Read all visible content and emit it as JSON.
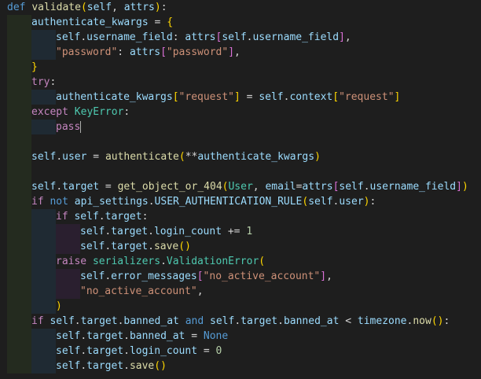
{
  "theme": {
    "background": "#1e1e1e",
    "indent_guide_colors": [
      "#242b1f",
      "#1f2a33",
      "#2a1f2f"
    ],
    "text": "#d4d4d4",
    "keyword": "#569cd6",
    "control": "#c586c0",
    "function": "#dcdcaa",
    "variable": "#9cdcfe",
    "string": "#ce9178",
    "class": "#4ec9b0",
    "number": "#b5cea8"
  },
  "editor": {
    "cursor_line": 8,
    "lines": [
      {
        "indent": 0,
        "tokens": [
          [
            "kw",
            "def "
          ],
          [
            "fn",
            "validate"
          ],
          [
            "br1",
            "("
          ],
          [
            "var",
            "self"
          ],
          [
            "op",
            ", "
          ],
          [
            "var",
            "attrs"
          ],
          [
            "br1",
            ")"
          ],
          [
            "op",
            ":"
          ]
        ]
      },
      {
        "indent": 1,
        "tokens": [
          [
            "var",
            "authenticate_kwargs"
          ],
          [
            "op",
            " = "
          ],
          [
            "br1",
            "{"
          ]
        ]
      },
      {
        "indent": 2,
        "tokens": [
          [
            "var",
            "self"
          ],
          [
            "op",
            "."
          ],
          [
            "var",
            "username_field"
          ],
          [
            "op",
            ": "
          ],
          [
            "var",
            "attrs"
          ],
          [
            "br2",
            "["
          ],
          [
            "var",
            "self"
          ],
          [
            "op",
            "."
          ],
          [
            "var",
            "username_field"
          ],
          [
            "br2",
            "]"
          ],
          [
            "op",
            ","
          ]
        ]
      },
      {
        "indent": 2,
        "tokens": [
          [
            "str",
            "\"password\""
          ],
          [
            "op",
            ": "
          ],
          [
            "var",
            "attrs"
          ],
          [
            "br2",
            "["
          ],
          [
            "str",
            "\"password\""
          ],
          [
            "br2",
            "]"
          ],
          [
            "op",
            ","
          ]
        ]
      },
      {
        "indent": 1,
        "tokens": [
          [
            "br1",
            "}"
          ]
        ]
      },
      {
        "indent": 1,
        "tokens": [
          [
            "ctl",
            "try"
          ],
          [
            "op",
            ":"
          ]
        ]
      },
      {
        "indent": 2,
        "tokens": [
          [
            "var",
            "authenticate_kwargs"
          ],
          [
            "br1",
            "["
          ],
          [
            "str",
            "\"request\""
          ],
          [
            "br1",
            "]"
          ],
          [
            "op",
            " = "
          ],
          [
            "var",
            "self"
          ],
          [
            "op",
            "."
          ],
          [
            "var",
            "context"
          ],
          [
            "br1",
            "["
          ],
          [
            "str",
            "\"request\""
          ],
          [
            "br1",
            "]"
          ]
        ]
      },
      {
        "indent": 1,
        "tokens": [
          [
            "ctl",
            "except "
          ],
          [
            "cls",
            "KeyError"
          ],
          [
            "op",
            ":"
          ]
        ]
      },
      {
        "indent": 2,
        "tokens": [
          [
            "ctl",
            "pass"
          ]
        ]
      },
      {
        "indent": 1,
        "tokens": []
      },
      {
        "indent": 1,
        "tokens": [
          [
            "var",
            "self"
          ],
          [
            "op",
            "."
          ],
          [
            "var",
            "user"
          ],
          [
            "op",
            " = "
          ],
          [
            "fn",
            "authenticate"
          ],
          [
            "br1",
            "("
          ],
          [
            "op",
            "**"
          ],
          [
            "var",
            "authenticate_kwargs"
          ],
          [
            "br1",
            ")"
          ]
        ]
      },
      {
        "indent": 1,
        "tokens": []
      },
      {
        "indent": 1,
        "tokens": [
          [
            "var",
            "self"
          ],
          [
            "op",
            "."
          ],
          [
            "var",
            "target"
          ],
          [
            "op",
            " = "
          ],
          [
            "fn",
            "get_object_or_404"
          ],
          [
            "br1",
            "("
          ],
          [
            "cls",
            "User"
          ],
          [
            "op",
            ", "
          ],
          [
            "var",
            "email"
          ],
          [
            "op",
            "="
          ],
          [
            "var",
            "attrs"
          ],
          [
            "br2",
            "["
          ],
          [
            "var",
            "self"
          ],
          [
            "op",
            "."
          ],
          [
            "var",
            "username_field"
          ],
          [
            "br2",
            "]"
          ],
          [
            "br1",
            ")"
          ]
        ]
      },
      {
        "indent": 1,
        "tokens": [
          [
            "ctl",
            "if "
          ],
          [
            "kw",
            "not "
          ],
          [
            "var",
            "api_settings"
          ],
          [
            "op",
            "."
          ],
          [
            "var",
            "USER_AUTHENTICATION_RULE"
          ],
          [
            "br1",
            "("
          ],
          [
            "var",
            "self"
          ],
          [
            "op",
            "."
          ],
          [
            "var",
            "user"
          ],
          [
            "br1",
            ")"
          ],
          [
            "op",
            ":"
          ]
        ]
      },
      {
        "indent": 2,
        "tokens": [
          [
            "ctl",
            "if "
          ],
          [
            "var",
            "self"
          ],
          [
            "op",
            "."
          ],
          [
            "var",
            "target"
          ],
          [
            "op",
            ":"
          ]
        ]
      },
      {
        "indent": 3,
        "tokens": [
          [
            "var",
            "self"
          ],
          [
            "op",
            "."
          ],
          [
            "var",
            "target"
          ],
          [
            "op",
            "."
          ],
          [
            "var",
            "login_count"
          ],
          [
            "op",
            " += "
          ],
          [
            "num",
            "1"
          ]
        ]
      },
      {
        "indent": 3,
        "tokens": [
          [
            "var",
            "self"
          ],
          [
            "op",
            "."
          ],
          [
            "var",
            "target"
          ],
          [
            "op",
            "."
          ],
          [
            "fn",
            "save"
          ],
          [
            "br1",
            "()"
          ]
        ]
      },
      {
        "indent": 2,
        "tokens": [
          [
            "ctl",
            "raise "
          ],
          [
            "cls",
            "serializers"
          ],
          [
            "op",
            "."
          ],
          [
            "cls",
            "ValidationError"
          ],
          [
            "br1",
            "("
          ]
        ]
      },
      {
        "indent": 3,
        "tokens": [
          [
            "var",
            "self"
          ],
          [
            "op",
            "."
          ],
          [
            "var",
            "error_messages"
          ],
          [
            "br2",
            "["
          ],
          [
            "str",
            "\"no_active_account\""
          ],
          [
            "br2",
            "]"
          ],
          [
            "op",
            ","
          ]
        ]
      },
      {
        "indent": 3,
        "tokens": [
          [
            "str",
            "\"no_active_account\""
          ],
          [
            "op",
            ","
          ]
        ]
      },
      {
        "indent": 2,
        "tokens": [
          [
            "br1",
            ")"
          ]
        ]
      },
      {
        "indent": 1,
        "tokens": [
          [
            "ctl",
            "if "
          ],
          [
            "var",
            "self"
          ],
          [
            "op",
            "."
          ],
          [
            "var",
            "target"
          ],
          [
            "op",
            "."
          ],
          [
            "var",
            "banned_at"
          ],
          [
            "kw",
            " and "
          ],
          [
            "var",
            "self"
          ],
          [
            "op",
            "."
          ],
          [
            "var",
            "target"
          ],
          [
            "op",
            "."
          ],
          [
            "var",
            "banned_at"
          ],
          [
            "op",
            " < "
          ],
          [
            "var",
            "timezone"
          ],
          [
            "op",
            "."
          ],
          [
            "fn",
            "now"
          ],
          [
            "br1",
            "()"
          ],
          [
            "op",
            ":"
          ]
        ]
      },
      {
        "indent": 2,
        "tokens": [
          [
            "var",
            "self"
          ],
          [
            "op",
            "."
          ],
          [
            "var",
            "target"
          ],
          [
            "op",
            "."
          ],
          [
            "var",
            "banned_at"
          ],
          [
            "op",
            " = "
          ],
          [
            "kw",
            "None"
          ]
        ]
      },
      {
        "indent": 2,
        "tokens": [
          [
            "var",
            "self"
          ],
          [
            "op",
            "."
          ],
          [
            "var",
            "target"
          ],
          [
            "op",
            "."
          ],
          [
            "var",
            "login_count"
          ],
          [
            "op",
            " = "
          ],
          [
            "num",
            "0"
          ]
        ]
      },
      {
        "indent": 2,
        "tokens": [
          [
            "var",
            "self"
          ],
          [
            "op",
            "."
          ],
          [
            "var",
            "target"
          ],
          [
            "op",
            "."
          ],
          [
            "fn",
            "save"
          ],
          [
            "br1",
            "()"
          ]
        ]
      }
    ]
  }
}
